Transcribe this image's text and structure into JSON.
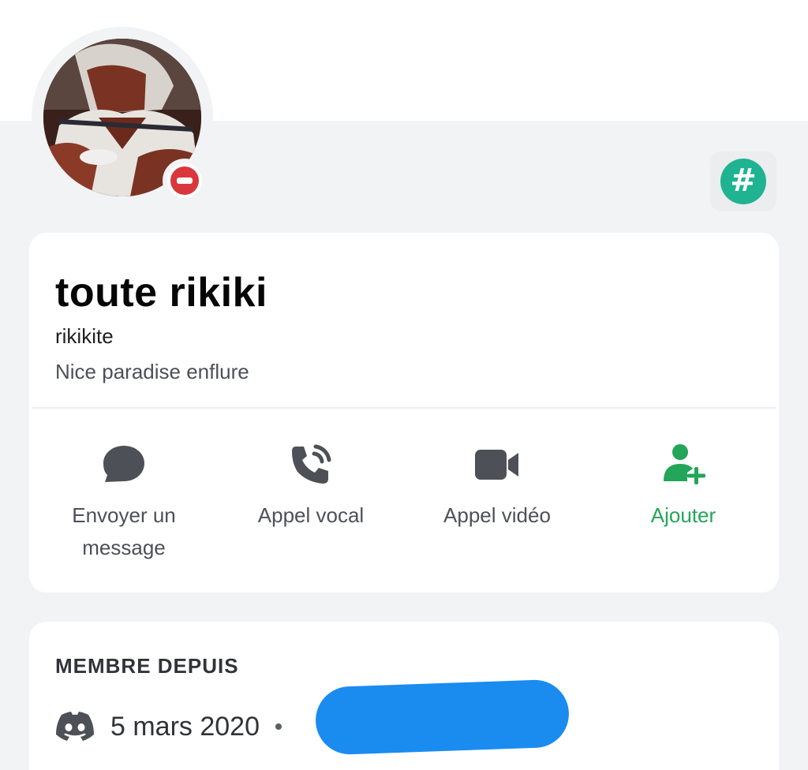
{
  "profile": {
    "display_name": "toute rikiki",
    "username": "rikikite",
    "custom_status": "Nice paradise enflure",
    "presence": "do-not-disturb",
    "avatar_icon": "anime-character-avatar",
    "badge_icon": "hashtag-icon"
  },
  "actions": [
    {
      "label": "Envoyer un message",
      "icon": "message-bubble-icon"
    },
    {
      "label": "Appel vocal",
      "icon": "phone-call-icon"
    },
    {
      "label": "Appel vidéo",
      "icon": "video-camera-icon"
    },
    {
      "label": "Ajouter",
      "icon": "add-friend-icon"
    }
  ],
  "member_since": {
    "title": "MEMBRE DEPUIS",
    "discord_date": "5 mars 2020",
    "discord_icon": "discord-logo-icon",
    "server_date_redacted": true
  },
  "colors": {
    "accent_green": "#23a55a",
    "dnd_red": "#da373c",
    "badge_teal": "#1fb391",
    "redaction_blue": "#1a8cf0",
    "icon_gray": "#4e5058"
  }
}
